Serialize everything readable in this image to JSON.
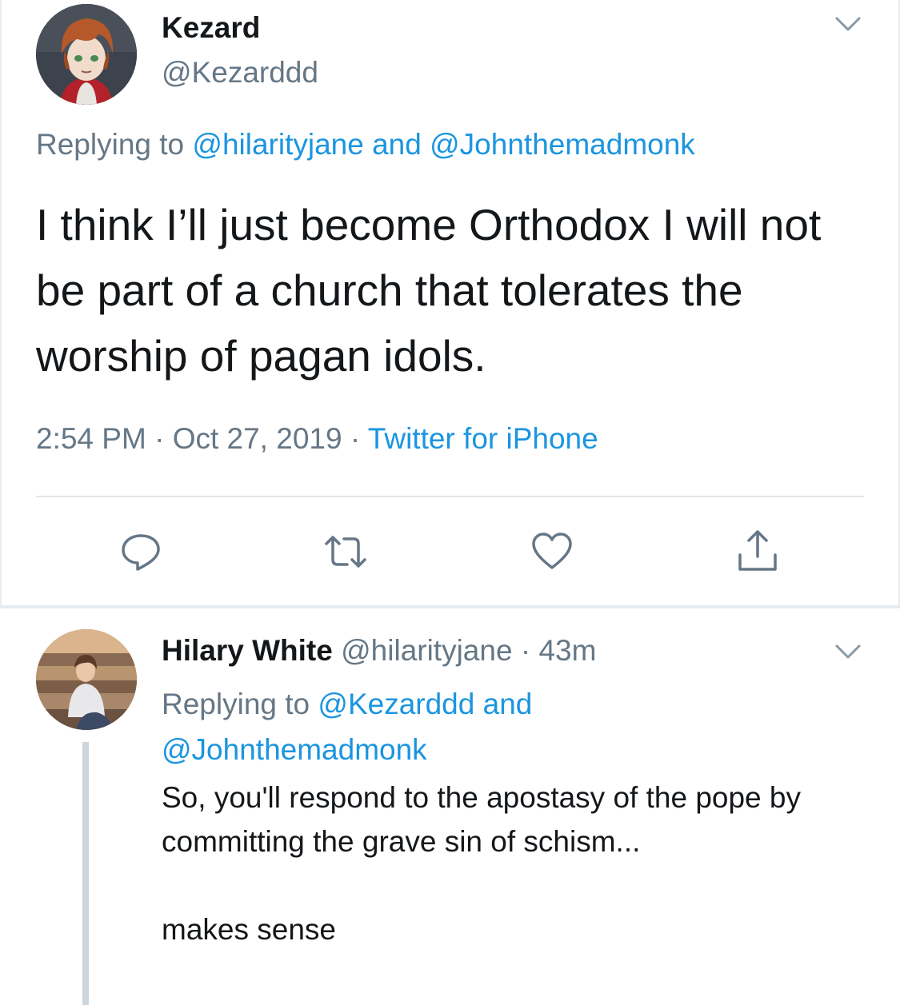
{
  "main_tweet": {
    "name": "Kezard",
    "handle": "@Kezarddd",
    "replying_prefix": "Replying to",
    "replying_user1": "@hilarityjane",
    "replying_and": "and",
    "replying_user2": "@Johnthemadmonk",
    "text": "I think I’ll just become Orthodox I will not be part of a church that tolerates the worship of pagan idols.",
    "time": "2:54 PM",
    "separator": "·",
    "date": "Oct 27, 2019",
    "source": "Twitter for iPhone",
    "actions": {
      "reply_icon": "reply-icon",
      "retweet_icon": "retweet-icon",
      "like_icon": "heart-icon",
      "share_icon": "share-icon"
    }
  },
  "reply_tweet": {
    "name": "Hilary White",
    "handle": "@hilarityjane",
    "separator": "·",
    "age": "43m",
    "replying_prefix": "Replying to",
    "replying_user1": "@Kezarddd",
    "replying_and": "and",
    "replying_user2": "@Johnthemadmonk",
    "text": "So, you'll respond to the apostasy of the pope by committing the grave sin of schism...\n\nmakes sense"
  },
  "colors": {
    "link": "#1b95e0",
    "secondary": "#657786",
    "primary": "#14171a",
    "divider": "#e1e8ed",
    "thread_line": "#ccd6dd"
  }
}
